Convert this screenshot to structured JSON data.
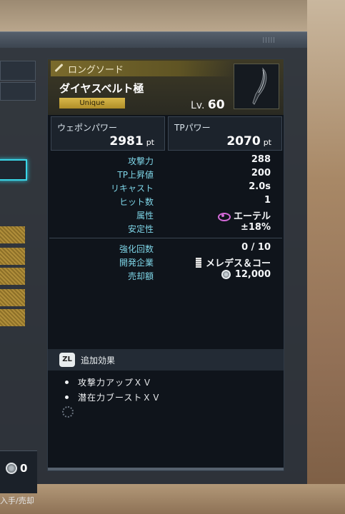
{
  "left_panel": {
    "money": "0",
    "footer_text": "入手/売却"
  },
  "weapon": {
    "category": "ロングソード",
    "name": "ダイヤスベルト極",
    "rarity": "Unique",
    "level_label": "Lv.",
    "level": "60",
    "weapon_power_label": "ウェポンパワー",
    "weapon_power": "2981",
    "tp_power_label": "TPパワー",
    "tp_power": "2070",
    "unit": "pt"
  },
  "stats": [
    {
      "label": "攻撃力",
      "value": "288"
    },
    {
      "label": "TP上昇値",
      "value": "200"
    },
    {
      "label": "リキャスト",
      "value": "2.0s"
    },
    {
      "label": "ヒット数",
      "value": "1"
    },
    {
      "label": "属性",
      "value": "エーテル",
      "icon": "ether-icon"
    },
    {
      "label": "安定性",
      "value": "±18%"
    }
  ],
  "info": [
    {
      "label": "強化回数",
      "value": "0 / 10"
    },
    {
      "label": "開発企業",
      "value": "メレデス＆コー",
      "icon": "maker-logo-icon"
    },
    {
      "label": "売却額",
      "value": "12,000",
      "icon": "coin-icon"
    }
  ],
  "effects": {
    "button": "ZL",
    "title": "追加効果",
    "items": [
      "攻撃力アップＸＶ",
      "潜在力ブーストＸＶ"
    ]
  },
  "colors": {
    "accent_cyan": "#7fd6e8",
    "rarity_gold": "#d8b84a",
    "ether_purple": "#d46ad8",
    "selection_cyan": "#3ad6e8"
  }
}
